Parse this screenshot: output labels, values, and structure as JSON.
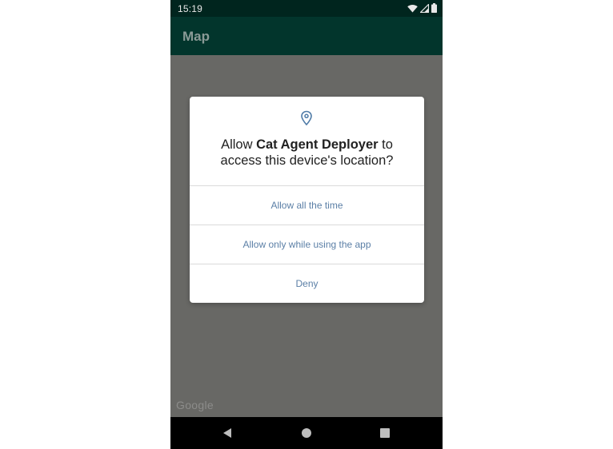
{
  "status_bar": {
    "time": "15:19",
    "icons": [
      "wifi-icon",
      "cell-signal-icon",
      "battery-icon"
    ]
  },
  "app_bar": {
    "title": "Map"
  },
  "map": {
    "attribution": "Google"
  },
  "dialog": {
    "icon": "location-pin-icon",
    "title_prefix": "Allow ",
    "app_name": "Cat Agent Deployer",
    "title_suffix_line1": " to",
    "title_line2": "access this device's location?",
    "options": [
      {
        "label": "Allow all the time"
      },
      {
        "label": "Allow only while using the app"
      },
      {
        "label": "Deny"
      }
    ]
  },
  "nav_bar": {
    "buttons": [
      "back-icon",
      "home-icon",
      "recents-icon"
    ]
  },
  "colors": {
    "status_bar": "#00251e",
    "app_bar": "#02352c",
    "scrim": "#686865",
    "dialog_button_text": "#5b7fa6",
    "icon_accent": "#4f7ba7"
  }
}
